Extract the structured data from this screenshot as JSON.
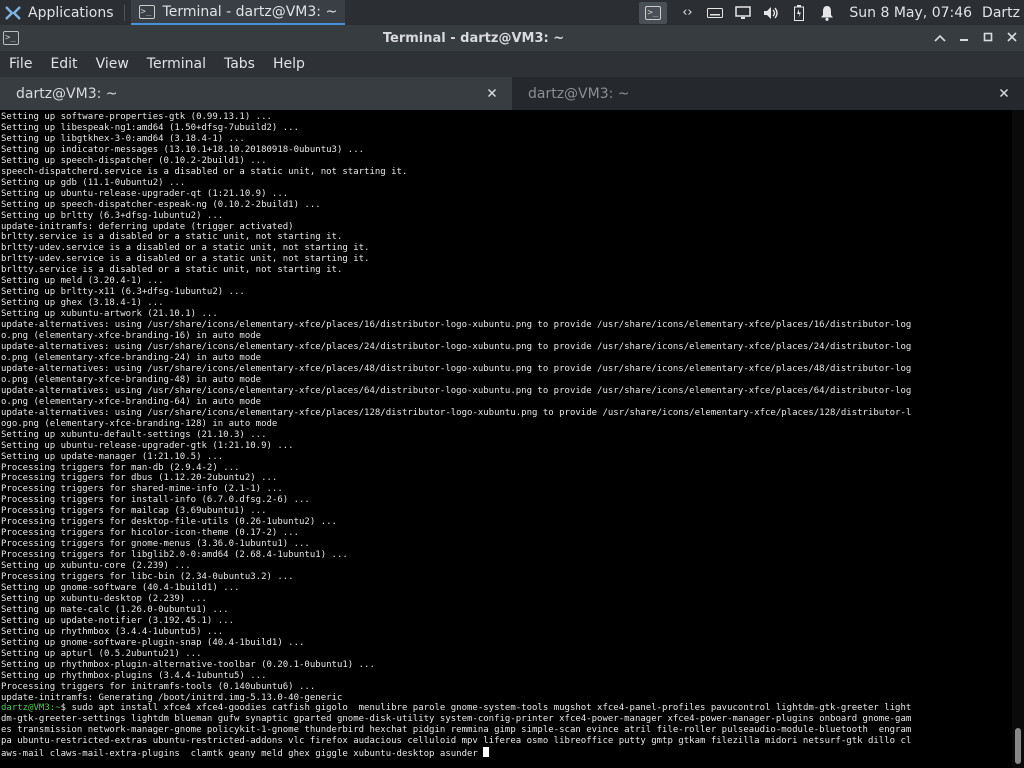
{
  "panel": {
    "applications_label": "Applications",
    "task_title": "Terminal - dartz@VM3: ~",
    "clock": "Sun  8 May, 07:46",
    "user": "Dartz",
    "icons": [
      "xfce-logo-icon",
      "terminal-icon",
      "keyboard-arrows-icon",
      "keyboard-icon",
      "display-icon",
      "volume-icon",
      "battery-icon",
      "notifications-icon"
    ]
  },
  "window": {
    "title": "Terminal - dartz@VM3: ~",
    "controls": [
      "chevron-up-icon",
      "minimize-icon",
      "maximize-icon",
      "close-icon"
    ]
  },
  "menu": [
    "File",
    "Edit",
    "View",
    "Terminal",
    "Tabs",
    "Help"
  ],
  "tabs": [
    {
      "label": "dartz@VM3: ~",
      "active": true
    },
    {
      "label": "dartz@VM3: ~",
      "active": false
    }
  ],
  "terminal": {
    "lines": [
      "Setting up software-properties-gtk (0.99.13.1) ...",
      "Setting up libespeak-ng1:amd64 (1.50+dfsg-7ubuild2) ...",
      "Setting up libgtkhex-3-0:amd64 (3.18.4-1) ...",
      "Setting up indicator-messages (13.10.1+18.10.20180918-0ubuntu3) ...",
      "Setting up speech-dispatcher (0.10.2-2build1) ...",
      "speech-dispatcherd.service is a disabled or a static unit, not starting it.",
      "Setting up gdb (11.1-0ubuntu2) ...",
      "Setting up ubuntu-release-upgrader-qt (1:21.10.9) ...",
      "Setting up speech-dispatcher-espeak-ng (0.10.2-2build1) ...",
      "Setting up brltty (6.3+dfsg-1ubuntu2) ...",
      "update-initramfs: deferring update (trigger activated)",
      "brltty.service is a disabled or a static unit, not starting it.",
      "brltty-udev.service is a disabled or a static unit, not starting it.",
      "brltty-udev.service is a disabled or a static unit, not starting it.",
      "brltty.service is a disabled or a static unit, not starting it.",
      "Setting up meld (3.20.4-1) ...",
      "Setting up brltty-x11 (6.3+dfsg-1ubuntu2) ...",
      "Setting up ghex (3.18.4-1) ...",
      "Setting up xubuntu-artwork (21.10.1) ...",
      "update-alternatives: using /usr/share/icons/elementary-xfce/places/16/distributor-logo-xubuntu.png to provide /usr/share/icons/elementary-xfce/places/16/distributor-log",
      "o.png (elementary-xfce-branding-16) in auto mode",
      "update-alternatives: using /usr/share/icons/elementary-xfce/places/24/distributor-logo-xubuntu.png to provide /usr/share/icons/elementary-xfce/places/24/distributor-log",
      "o.png (elementary-xfce-branding-24) in auto mode",
      "update-alternatives: using /usr/share/icons/elementary-xfce/places/48/distributor-logo-xubuntu.png to provide /usr/share/icons/elementary-xfce/places/48/distributor-log",
      "o.png (elementary-xfce-branding-48) in auto mode",
      "update-alternatives: using /usr/share/icons/elementary-xfce/places/64/distributor-logo-xubuntu.png to provide /usr/share/icons/elementary-xfce/places/64/distributor-log",
      "o.png (elementary-xfce-branding-64) in auto mode",
      "update-alternatives: using /usr/share/icons/elementary-xfce/places/128/distributor-logo-xubuntu.png to provide /usr/share/icons/elementary-xfce/places/128/distributor-l",
      "ogo.png (elementary-xfce-branding-128) in auto mode",
      "Setting up xubuntu-default-settings (21.10.3) ...",
      "Setting up ubuntu-release-upgrader-gtk (1:21.10.9) ...",
      "Setting up update-manager (1:21.10.5) ...",
      "Processing triggers for man-db (2.9.4-2) ...",
      "Processing triggers for dbus (1.12.20-2ubuntu2) ...",
      "Processing triggers for shared-mime-info (2.1-1) ...",
      "Processing triggers for install-info (6.7.0.dfsg.2-6) ...",
      "Processing triggers for mailcap (3.69ubuntu1) ...",
      "Processing triggers for desktop-file-utils (0.26-1ubuntu2) ...",
      "Processing triggers for hicolor-icon-theme (0.17-2) ...",
      "Processing triggers for gnome-menus (3.36.0-1ubuntu1) ...",
      "Processing triggers for libglib2.0-0:amd64 (2.68.4-1ubuntu1) ...",
      "Setting up xubuntu-core (2.239) ...",
      "Processing triggers for libc-bin (2.34-0ubuntu3.2) ...",
      "Setting up gnome-software (40.4-1build1) ...",
      "Setting up xubuntu-desktop (2.239) ...",
      "Setting up mate-calc (1.26.0-0ubuntu1) ...",
      "Setting up update-notifier (3.192.45.1) ...",
      "Setting up rhythmbox (3.4.4-1ubuntu5) ...",
      "Setting up gnome-software-plugin-snap (40.4-1build1) ...",
      "Setting up apturl (0.5.2ubuntu21) ...",
      "Setting up rhythmbox-plugin-alternative-toolbar (0.20.1-0ubuntu1) ...",
      "Setting up rhythmbox-plugins (3.4.4-1ubuntu5) ...",
      "Processing triggers for initramfs-tools (0.140ubuntu6) ...",
      "update-initramfs: Generating /boot/initrd.img-5.13.0-40-generic"
    ],
    "prompt": "dartz@VM3:~",
    "command_lines": [
      "$ sudo apt install xfce4 xfce4-goodies catfish gigolo  menulibre parole gnome-system-tools mugshot xfce4-panel-profiles pavucontrol lightdm-gtk-greeter light",
      "dm-gtk-greeter-settings lightdm blueman gufw synaptic gparted gnome-disk-utility system-config-printer xfce4-power-manager xfce4-power-manager-plugins onboard gnome-gam",
      "es transmission network-manager-gnome policykit-1-gnome thunderbird hexchat pidgin remmina gimp simple-scan evince atril file-roller pulseaudio-module-bluetooth  engram",
      "pa ubuntu-restricted-extras ubuntu-restricted-addons vlc firefox audacious celluloid mpv liferea osmo libreoffice putty gmtp gtkam filezilla midori netsurf-gtk dillo cl",
      "aws-mail claws-mail-extra-plugins  clamtk geany meld ghex giggle xubuntu-desktop asunder "
    ]
  }
}
